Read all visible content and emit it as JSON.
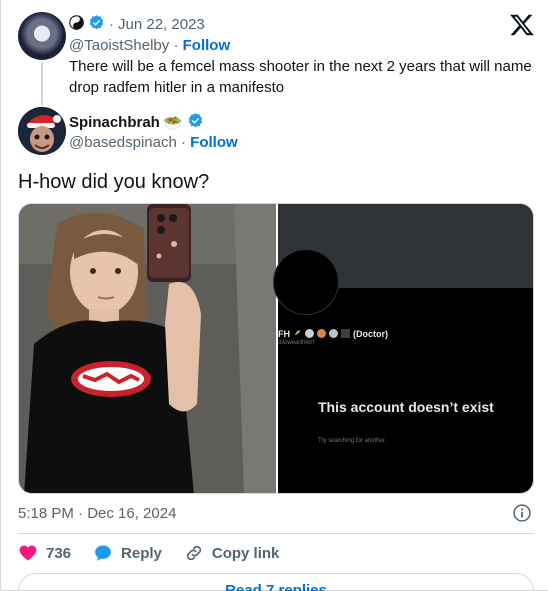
{
  "parent_tweet": {
    "date": "Jun 22, 2023",
    "handle": "@TaoistShelby",
    "follow_label": "Follow",
    "text": "There will be a femcel mass shooter in the next 2 years that will name drop radfem hitler in a manifesto"
  },
  "reply_tweet": {
    "display_name": "Spinachbrah",
    "name_emoji": "🥗",
    "handle": "@basedspinach",
    "follow_label": "Follow",
    "text": "H-how did you know?",
    "timestamp": "5:18 PM · Dec 16, 2024",
    "separator": "·"
  },
  "media": {
    "right_screenshot": {
      "name_text": "FH",
      "name_suffix": "(Doctor)",
      "handle_text": "ollowearthterf",
      "title": "This account doesn’t exist",
      "subtitle": "Try searching for another."
    }
  },
  "actions": {
    "likes_count": "736",
    "reply_label": "Reply",
    "copy_link_label": "Copy link"
  },
  "read_replies_label": "Read 7 replies",
  "colors": {
    "link_blue": "#006fd6",
    "like_red": "#f91880",
    "verified_blue": "#1d9bf0",
    "muted": "#536471"
  }
}
